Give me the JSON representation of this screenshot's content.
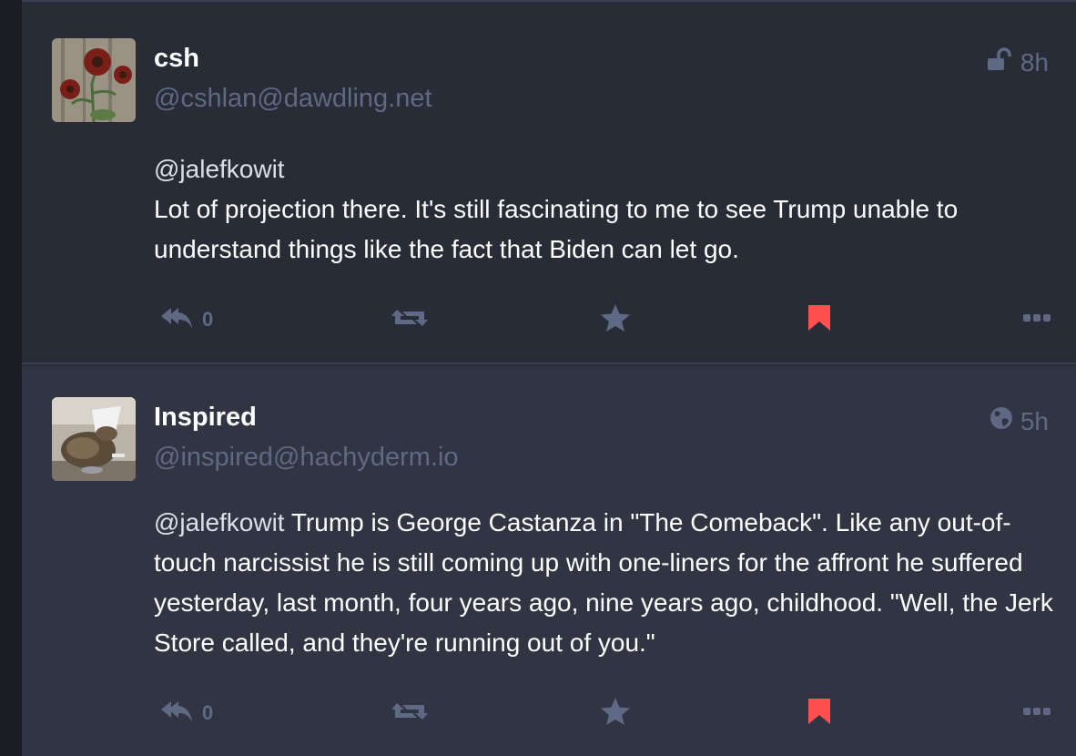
{
  "statuses": [
    {
      "display_name": "csh",
      "account": "@cshlan@dawdling.net",
      "visibility_icon": "unlock-icon",
      "time": "8h",
      "mention": "@jalefkowit",
      "text": "Lot of projection there. It's still fascinating to me to see Trump unable to understand things like the fact that Biden can let go.",
      "reply_count": "0",
      "bookmarked": true,
      "bookmark_color": "#ff5050"
    },
    {
      "display_name": "Inspired",
      "account": "@inspired@hachyderm.io",
      "visibility_icon": "globe-icon",
      "time": "5h",
      "mention": "@jalefkowit",
      "text": " Trump is George Castanza in \"The Comeback\". Like any out-of-touch narcissist he is still coming up with one-liners for the affront he suffered yesterday, last month, four years ago, nine years ago, childhood. \"Well, the Jerk Store called, and they're running out of you.\"",
      "reply_count": "0",
      "bookmarked": true,
      "bookmark_color": "#ff5050"
    }
  ]
}
